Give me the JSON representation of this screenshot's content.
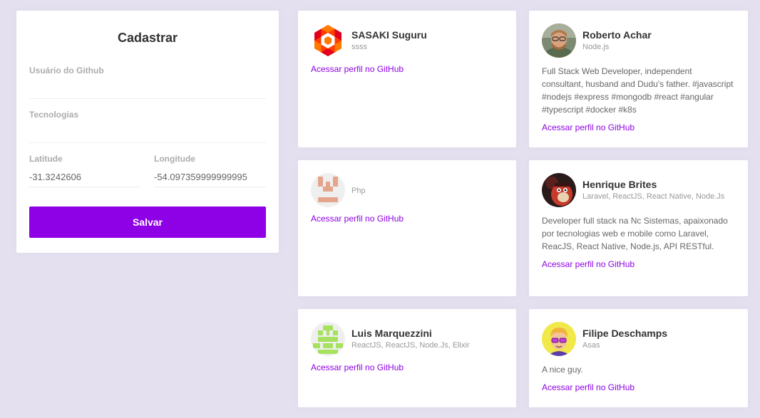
{
  "form": {
    "title": "Cadastrar",
    "github_user_label": "Usuário do Github",
    "github_user_value": "",
    "techs_label": "Tecnologias",
    "techs_value": "",
    "latitude_label": "Latitude",
    "latitude_value": "-31.3242606",
    "longitude_label": "Longitude",
    "longitude_value": "-54.097359999999995",
    "save_label": "Salvar"
  },
  "colors": {
    "background": "#e4e0ef",
    "accent": "#8e00e6"
  },
  "devs": [
    {
      "name": "SASAKI Suguru",
      "techs": "ssss",
      "bio": "",
      "link": "Acessar perfil no GitHub",
      "avatar": "hexagon-identicon-avatar"
    },
    {
      "name": "Roberto Achar",
      "techs": "Node.js",
      "bio": "Full Stack Web Developer, independent consultant, husband and Dudu's father. #javascript #nodejs #express #mongodb #react #angular #typescript #docker #k8s",
      "link": "Acessar perfil no GitHub",
      "avatar": "photo-avatar"
    },
    {
      "name": "",
      "techs": "Php",
      "bio": "",
      "link": "Acessar perfil no GitHub",
      "avatar": "pixel-identicon-avatar"
    },
    {
      "name": "Henrique Brites",
      "techs": "Laravel, ReactJS, React Native, Node.Js",
      "bio": "Developer full stack na Nc Sistemas, apaixonado por tecnologias web e mobile como Laravel, ReacJS, React Native, Node.js, API RESTful.",
      "link": "Acessar perfil no GitHub",
      "avatar": "photo-avatar"
    },
    {
      "name": "Luis Marquezzini",
      "techs": "ReactJS, ReactJS, Node.Js, Elixir",
      "bio": "",
      "link": "Acessar perfil no GitHub",
      "avatar": "pixel-identicon-avatar"
    },
    {
      "name": "Filipe Deschamps",
      "techs": "Asas",
      "bio": "A nice guy.",
      "link": "Acessar perfil no GitHub",
      "avatar": "cartoon-avatar"
    }
  ]
}
